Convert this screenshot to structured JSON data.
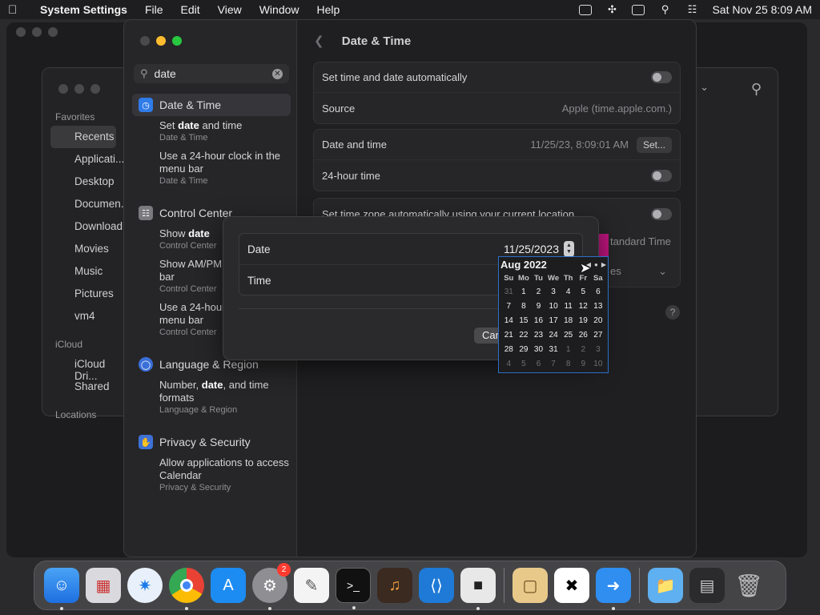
{
  "menubar": {
    "app_name": "System Settings",
    "menus": [
      "File",
      "Edit",
      "View",
      "Window",
      "Help"
    ],
    "clock": "Sat Nov 25  8:09 AM"
  },
  "finder": {
    "favorites_label": "Favorites",
    "favorites": [
      "Recents",
      "Applicati...",
      "Desktop",
      "Documen...",
      "Download",
      "Movies",
      "Music",
      "Pictures",
      "vm4"
    ],
    "icloud_label": "iCloud",
    "icloud": [
      "iCloud Dri...",
      "Shared"
    ],
    "locations_label": "Locations"
  },
  "settings": {
    "search": {
      "value": "date"
    },
    "results": [
      {
        "title": "Date & Time",
        "icon": "calendar-clock-icon",
        "items": [
          {
            "text": "Set <b>date</b> and time",
            "source": "Date & Time"
          },
          {
            "text": "Use a 24-hour clock in the menu bar",
            "source": "Date & Time"
          }
        ]
      },
      {
        "title": "Control Center",
        "icon": "control-center-icon",
        "items": [
          {
            "text": "Show <b>date</b>",
            "source": "Control Center"
          },
          {
            "text": "Show AM/PM in the menu bar",
            "source": "Control Center"
          },
          {
            "text": "Use a 24-hour clock in the menu bar",
            "source": "Control Center"
          }
        ]
      },
      {
        "title": "Language & Region",
        "icon": "globe-icon",
        "items": [
          {
            "text": "Number, <b>date</b>, and time formats",
            "source": "Language & Region"
          }
        ]
      },
      {
        "title": "Privacy & Security",
        "icon": "hand-icon",
        "items": [
          {
            "text": "Allow applications to access Calendar",
            "source": "Privacy & Security"
          }
        ]
      }
    ],
    "page_title": "Date & Time",
    "rows": {
      "auto_set": "Set time and date automatically",
      "source_label": "Source",
      "source_value": "Apple (time.apple.com.)",
      "date_time_label": "Date and time",
      "date_time_value": "11/25/23, 8:09:01 AM",
      "set_button": "Set...",
      "hour24": "24-hour time",
      "auto_tz": "Set time zone automatically using your current location",
      "tz_peek": "tandard Time",
      "closest_peek": "es"
    },
    "help": "?"
  },
  "sheet": {
    "date_label": "Date",
    "date_value": "11/25/2023",
    "time_label": "Time",
    "cancel": "Cancel"
  },
  "calendar": {
    "month": "Aug 2022",
    "dow": [
      "Su",
      "Mo",
      "Tu",
      "We",
      "Th",
      "Fr",
      "Sa"
    ],
    "weeks": [
      [
        "31",
        "1",
        "2",
        "3",
        "4",
        "5",
        "6"
      ],
      [
        "7",
        "8",
        "9",
        "10",
        "11",
        "12",
        "13"
      ],
      [
        "14",
        "15",
        "16",
        "17",
        "18",
        "19",
        "20"
      ],
      [
        "21",
        "22",
        "23",
        "24",
        "25",
        "26",
        "27"
      ],
      [
        "28",
        "29",
        "30",
        "31",
        "1",
        "2",
        "3"
      ],
      [
        "4",
        "5",
        "6",
        "7",
        "8",
        "9",
        "10"
      ]
    ]
  },
  "dock": {
    "apps": [
      "finder",
      "launchpad",
      "safari",
      "chrome",
      "app-store",
      "system-settings",
      "textedit",
      "terminal",
      "garageband",
      "vscode",
      "roblox",
      "preview",
      "capcut",
      "migration-assistant",
      "applications-folder",
      "downloads-stack",
      "trash"
    ],
    "settings_badge": "2"
  }
}
